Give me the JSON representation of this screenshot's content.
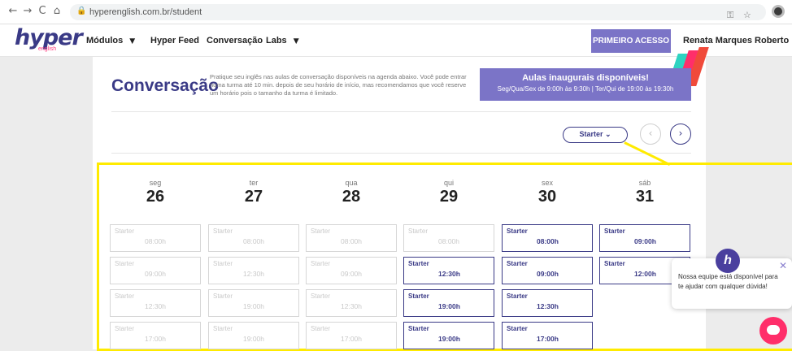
{
  "browser": {
    "back_icon": "←",
    "forward_icon": "→",
    "reload_icon": "C",
    "home_icon": "⌂",
    "lock_icon": "🔒",
    "url": "hyperenglish.com.br/student",
    "key_icon": "⚿",
    "star_icon": "☆"
  },
  "header": {
    "logo_main": "hyper",
    "logo_sub": "english",
    "menu": [
      {
        "label": "Módulos",
        "has_caret": true
      },
      {
        "label": "Hyper Feed",
        "has_caret": false
      },
      {
        "label": "Conversação",
        "has_caret": false
      },
      {
        "label": "Labs",
        "has_caret": true
      }
    ],
    "caret": "▼",
    "cta": "PRIMEIRO ACESSO",
    "user_name": "Renata Marques Roberto",
    "user_caret": "▼"
  },
  "page": {
    "title": "Conversação",
    "description": "Pratique seu inglês nas aulas de conversação disponíveis na agenda abaixo. Você pode entrar numa turma até 10 min. depois de seu horário de início, mas recomendamos que você reserve um horário pois o tamanho da turma é limitado.",
    "announcement_title": "Aulas inaugurais disponíveis!",
    "announcement_sub": "Seg/Qua/Sex de 9:00h às 9:30h | Ter/Qui de 19:00 às 19:30h",
    "level_label": "Starter",
    "level_caret": "⌄",
    "prev_icon": "‹",
    "next_icon": "›"
  },
  "schedule": {
    "days": [
      {
        "name": "seg",
        "num": "26"
      },
      {
        "name": "ter",
        "num": "27"
      },
      {
        "name": "qua",
        "num": "28"
      },
      {
        "name": "qui",
        "num": "29"
      },
      {
        "name": "sex",
        "num": "30"
      },
      {
        "name": "sáb",
        "num": "31"
      }
    ],
    "slots": [
      [
        {
          "level": "Starter",
          "time": "08:00h",
          "available": false
        },
        {
          "level": "Starter",
          "time": "09:00h",
          "available": false
        },
        {
          "level": "Starter",
          "time": "12:30h",
          "available": false
        },
        {
          "level": "Starter",
          "time": "17:00h",
          "available": false
        }
      ],
      [
        {
          "level": "Starter",
          "time": "08:00h",
          "available": false
        },
        {
          "level": "Starter",
          "time": "12:30h",
          "available": false
        },
        {
          "level": "Starter",
          "time": "19:00h",
          "available": false
        },
        {
          "level": "Starter",
          "time": "19:00h",
          "available": false
        }
      ],
      [
        {
          "level": "Starter",
          "time": "08:00h",
          "available": false
        },
        {
          "level": "Starter",
          "time": "09:00h",
          "available": false
        },
        {
          "level": "Starter",
          "time": "12:30h",
          "available": false
        },
        {
          "level": "Starter",
          "time": "17:00h",
          "available": false
        }
      ],
      [
        {
          "level": "Starter",
          "time": "08:00h",
          "available": false
        },
        {
          "level": "Starter",
          "time": "12:30h",
          "available": true
        },
        {
          "level": "Starter",
          "time": "19:00h",
          "available": true
        },
        {
          "level": "Starter",
          "time": "19:00h",
          "available": true
        }
      ],
      [
        {
          "level": "Starter",
          "time": "08:00h",
          "available": true
        },
        {
          "level": "Starter",
          "time": "09:00h",
          "available": true
        },
        {
          "level": "Starter",
          "time": "12:30h",
          "available": true
        },
        {
          "level": "Starter",
          "time": "17:00h",
          "available": true
        }
      ],
      [
        {
          "level": "Starter",
          "time": "09:00h",
          "available": true
        },
        {
          "level": "Starter",
          "time": "12:00h",
          "available": true
        }
      ]
    ]
  },
  "chat": {
    "avatar_letter": "h",
    "message": "Nossa equipe está disponível para te ajudar com qualquer dúvida!",
    "close_icon": "✕"
  },
  "colors": {
    "brand": "#3a3a86",
    "accent": "#7b74c7",
    "highlight": "#ffeb00",
    "chat": "#ff2e6a"
  }
}
